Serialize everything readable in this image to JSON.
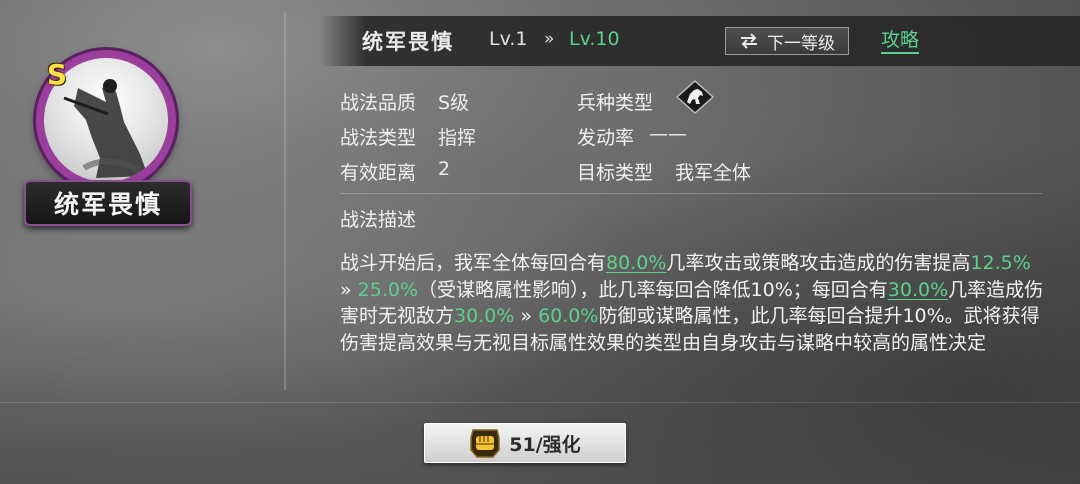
{
  "tactic": {
    "grade_badge": "S",
    "name_plate": "统军畏慎",
    "title": "统军畏慎",
    "level_current": "Lv.1",
    "level_arrow": "»",
    "level_max": "Lv.10"
  },
  "header": {
    "next_level_icon": "swap-arrows-icon",
    "next_level_label": "下一等级",
    "guide_label": "攻略"
  },
  "attributes": {
    "quality_key": "战法品质",
    "quality_val": "S级",
    "type_key": "战法类型",
    "type_val": "指挥",
    "range_key": "有效距离",
    "range_val": "2",
    "troop_key": "兵种类型",
    "troop_icon": "cavalry-horse-icon",
    "rate_key": "发动率",
    "rate_val": "——",
    "target_key": "目标类型",
    "target_val": "我军全体"
  },
  "description": {
    "title": "战法描述",
    "seg1": "战斗开始后，我军全体每回合有",
    "val1": "80.0%",
    "seg2": "几率攻击或策略攻击造成的伤害提高",
    "val2a": "12.5%",
    "arrow1": " » ",
    "val2b": "25.0%",
    "seg3": "（受谋略属性影响），此几率每回合降低10%；每回合有",
    "val3": "30.0%",
    "seg4": "几率造成伤害时无视敌方",
    "val4a": "30.0%",
    "arrow2": " » ",
    "val4b": "60.0%",
    "seg5": "防御或谋略属性，此几率每回合提升10%。武将获得伤害提高效果与无视目标属性效果的类型由自身攻击与谋略中较高的属性决定"
  },
  "upgrade": {
    "icon": "fist-icon",
    "label": "51/强化"
  },
  "colors": {
    "accent_green": "#5cd18f",
    "portrait_ring": "#9a3f9c",
    "grade_gold": "#ffe04a"
  }
}
